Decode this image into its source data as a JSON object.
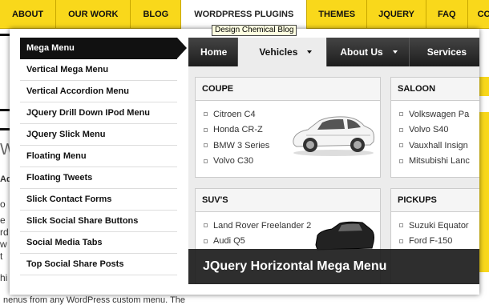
{
  "site_nav": {
    "items": [
      "ABOUT",
      "OUR WORK",
      "BLOG",
      "WORDPRESS PLUGINS",
      "THEMES",
      "JQUERY",
      "FAQ",
      "CONT"
    ],
    "active_index": 3
  },
  "tooltip": "Design Chemical Blog",
  "background": {
    "left_fragments": [
      "W",
      "Ad",
      "o",
      "e",
      "rd",
      "w",
      "t",
      "hi"
    ],
    "bottom_text": "nenus from any WordPress custom menu. The"
  },
  "menu_list": [
    "Mega Menu",
    "Vertical Mega Menu",
    "Vertical Accordion Menu",
    "JQuery Drill Down IPod Menu",
    "JQuery Slick Menu",
    "Floating Menu",
    "Floating Tweets",
    "Slick Contact Forms",
    "Slick Social Share Buttons",
    "Social Media Tabs",
    "Top Social Share Posts"
  ],
  "demo": {
    "tabs": [
      {
        "label": "Home",
        "dropdown": false
      },
      {
        "label": "Vehicles",
        "dropdown": true
      },
      {
        "label": "About Us",
        "dropdown": true
      },
      {
        "label": "Services",
        "dropdown": false
      }
    ],
    "active_tab": 1,
    "categories": [
      {
        "title": "COUPE",
        "items": [
          "Citroen C4",
          "Honda CR-Z",
          "BMW 3 Series",
          "Volvo C30"
        ]
      },
      {
        "title": "SALOON",
        "items": [
          "Volkswagen Pa",
          "Volvo S40",
          "Vauxhall Insign",
          "Mitsubishi Lanc"
        ]
      },
      {
        "title": "SUV'S",
        "items": [
          "Land Rover Freelander 2",
          "Audi Q5"
        ]
      },
      {
        "title": "PICKUPS",
        "items": [
          "Suzuki Equator",
          "Ford F-150"
        ]
      }
    ],
    "caption": "JQuery Horizontal Mega Menu"
  },
  "colors": {
    "brand_yellow": "#f9d81b",
    "menu_active": "#111111",
    "demo_bar": "#2a2a2a"
  }
}
